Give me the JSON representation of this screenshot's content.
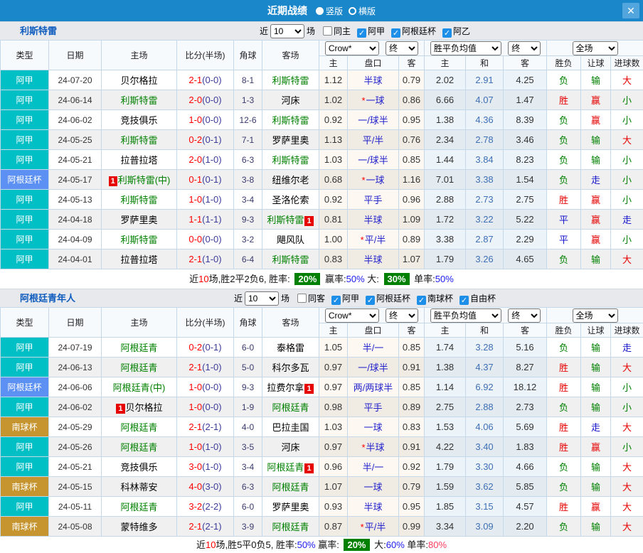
{
  "titlebar": {
    "title": "近期战绩",
    "vertical": "竖版",
    "horizontal": "横版",
    "close": "✕"
  },
  "table_headers": {
    "type": "类型",
    "date": "日期",
    "home": "主场",
    "score": "比分(半场)",
    "corner": "角球",
    "away": "客场",
    "ah_select": "Crow*",
    "ah_final": "终",
    "odds_select": "胜平负均值",
    "odds_final": "终",
    "scope_select": "全场",
    "ah_sub": [
      "主",
      "盘口",
      "客"
    ],
    "odds_sub": [
      "主",
      "和",
      "客"
    ],
    "res_sub": [
      "胜负",
      "让球",
      "进球数"
    ]
  },
  "colors": {
    "league": {
      "teal": "#00bfc5",
      "blue": "#5c90f2",
      "gold": "#c6952f"
    },
    "result": {
      "red": "#e60000",
      "green": "#008000",
      "blue": "#1414cc"
    },
    "accent_bar": "#1b87cb",
    "summary_badge": "#008000",
    "checkbox": "#1e8fe8"
  },
  "sections": [
    {
      "team": "利斯特雷",
      "filters": {
        "near_label": "近",
        "games": "10",
        "games_label": "场",
        "same_label": "同主",
        "same_checked": false,
        "leagues": [
          "阿甲",
          "阿根廷杯",
          "阿乙"
        ]
      },
      "rows": [
        {
          "league": "阿甲",
          "lc": "teal",
          "date": "24-07-20",
          "h": {
            "n": "贝尔格拉",
            "g": false,
            "b": ""
          },
          "ft": "2-1",
          "ht": "(0-0)",
          "cr": "8-1",
          "a": {
            "n": "利斯特雷",
            "g": true,
            "b": ""
          },
          "ah": [
            "1.12",
            "半球",
            false,
            "0.79"
          ],
          "od": [
            "2.02",
            "2.91",
            "4.25"
          ],
          "res": [
            [
              "负",
              "green"
            ],
            [
              "输",
              "green"
            ],
            [
              "大",
              "red"
            ]
          ]
        },
        {
          "league": "阿甲",
          "lc": "teal",
          "date": "24-06-14",
          "h": {
            "n": "利斯特雷",
            "g": true,
            "b": ""
          },
          "ft": "2-0",
          "ht": "(0-0)",
          "cr": "1-3",
          "a": {
            "n": "河床",
            "g": false,
            "b": ""
          },
          "ah": [
            "1.02",
            "一球",
            true,
            "0.86"
          ],
          "od": [
            "6.66",
            "4.07",
            "1.47"
          ],
          "res": [
            [
              "胜",
              "red"
            ],
            [
              "赢",
              "red"
            ],
            [
              "小",
              "green"
            ]
          ]
        },
        {
          "league": "阿甲",
          "lc": "teal",
          "date": "24-06-02",
          "h": {
            "n": "竞技俱乐",
            "g": false,
            "b": ""
          },
          "ft": "1-0",
          "ht": "(0-0)",
          "cr": "12-6",
          "a": {
            "n": "利斯特雷",
            "g": true,
            "b": ""
          },
          "ah": [
            "0.92",
            "一/球半",
            false,
            "0.95"
          ],
          "od": [
            "1.38",
            "4.36",
            "8.39"
          ],
          "res": [
            [
              "负",
              "green"
            ],
            [
              "赢",
              "red"
            ],
            [
              "小",
              "green"
            ]
          ]
        },
        {
          "league": "阿甲",
          "lc": "teal",
          "date": "24-05-25",
          "h": {
            "n": "利斯特雷",
            "g": true,
            "b": ""
          },
          "ft": "0-2",
          "ht": "(0-1)",
          "cr": "7-1",
          "a": {
            "n": "罗萨里奥",
            "g": false,
            "b": ""
          },
          "ah": [
            "1.13",
            "平/半",
            false,
            "0.76"
          ],
          "od": [
            "2.34",
            "2.78",
            "3.46"
          ],
          "res": [
            [
              "负",
              "green"
            ],
            [
              "输",
              "green"
            ],
            [
              "大",
              "red"
            ]
          ]
        },
        {
          "league": "阿甲",
          "lc": "teal",
          "date": "24-05-21",
          "h": {
            "n": "拉普拉塔",
            "g": false,
            "b": ""
          },
          "ft": "2-0",
          "ht": "(1-0)",
          "cr": "6-3",
          "a": {
            "n": "利斯特雷",
            "g": true,
            "b": ""
          },
          "ah": [
            "1.03",
            "一/球半",
            false,
            "0.85"
          ],
          "od": [
            "1.44",
            "3.84",
            "8.23"
          ],
          "res": [
            [
              "负",
              "green"
            ],
            [
              "输",
              "green"
            ],
            [
              "小",
              "green"
            ]
          ]
        },
        {
          "league": "阿根廷杯",
          "lc": "blue",
          "date": "24-05-17",
          "h": {
            "n": "利斯特雷(中)",
            "g": true,
            "b": "1"
          },
          "ft": "0-1",
          "ht": "(0-1)",
          "cr": "3-8",
          "a": {
            "n": "纽维尔老",
            "g": false,
            "b": ""
          },
          "ah": [
            "0.68",
            "一球",
            true,
            "1.16"
          ],
          "od": [
            "7.01",
            "3.38",
            "1.54"
          ],
          "res": [
            [
              "负",
              "green"
            ],
            [
              "走",
              "blue"
            ],
            [
              "小",
              "green"
            ]
          ]
        },
        {
          "league": "阿甲",
          "lc": "teal",
          "date": "24-05-13",
          "h": {
            "n": "利斯特雷",
            "g": true,
            "b": ""
          },
          "ft": "1-0",
          "ht": "(1-0)",
          "cr": "3-4",
          "a": {
            "n": "圣洛伦索",
            "g": false,
            "b": ""
          },
          "ah": [
            "0.92",
            "平手",
            false,
            "0.96"
          ],
          "od": [
            "2.88",
            "2.73",
            "2.75"
          ],
          "res": [
            [
              "胜",
              "red"
            ],
            [
              "赢",
              "red"
            ],
            [
              "小",
              "green"
            ]
          ]
        },
        {
          "league": "阿甲",
          "lc": "teal",
          "date": "24-04-18",
          "h": {
            "n": "罗萨里奥",
            "g": false,
            "b": ""
          },
          "ft": "1-1",
          "ht": "(1-1)",
          "cr": "9-3",
          "a": {
            "n": "利斯特雷",
            "g": true,
            "b": "1"
          },
          "ah": [
            "0.81",
            "半球",
            false,
            "1.09"
          ],
          "od": [
            "1.72",
            "3.22",
            "5.22"
          ],
          "res": [
            [
              "平",
              "blue"
            ],
            [
              "赢",
              "red"
            ],
            [
              "走",
              "blue"
            ]
          ]
        },
        {
          "league": "阿甲",
          "lc": "teal",
          "date": "24-04-09",
          "h": {
            "n": "利斯特雷",
            "g": true,
            "b": ""
          },
          "ft": "0-0",
          "ht": "(0-0)",
          "cr": "3-2",
          "a": {
            "n": "飓风队",
            "g": false,
            "b": ""
          },
          "ah": [
            "1.00",
            "平/半",
            true,
            "0.89"
          ],
          "od": [
            "3.38",
            "2.87",
            "2.29"
          ],
          "res": [
            [
              "平",
              "blue"
            ],
            [
              "赢",
              "red"
            ],
            [
              "小",
              "green"
            ]
          ]
        },
        {
          "league": "阿甲",
          "lc": "teal",
          "date": "24-04-01",
          "h": {
            "n": "拉普拉塔",
            "g": false,
            "b": ""
          },
          "ft": "2-1",
          "ht": "(1-0)",
          "cr": "6-4",
          "a": {
            "n": "利斯特雷",
            "g": true,
            "b": ""
          },
          "ah": [
            "0.83",
            "半球",
            false,
            "1.07"
          ],
          "od": [
            "1.79",
            "3.26",
            "4.65"
          ],
          "res": [
            [
              "负",
              "green"
            ],
            [
              "输",
              "green"
            ],
            [
              "大",
              "red"
            ]
          ]
        }
      ],
      "summary": [
        {
          "t": "近",
          "s": "plain"
        },
        {
          "t": "10",
          "s": "red"
        },
        {
          "t": "场,胜2平2负6, 胜率: ",
          "s": "plain"
        },
        {
          "t": "20%",
          "s": "greenbg"
        },
        {
          "t": " 赢率:",
          "s": "plain"
        },
        {
          "t": "50%",
          "s": "blue"
        },
        {
          "t": " 大: ",
          "s": "plain"
        },
        {
          "t": "30%",
          "s": "greenbg"
        },
        {
          "t": " 单率:",
          "s": "plain"
        },
        {
          "t": "50%",
          "s": "blue"
        }
      ]
    },
    {
      "team": "阿根廷青年人",
      "filters": {
        "near_label": "近",
        "games": "10",
        "games_label": "场",
        "same_label": "同客",
        "same_checked": false,
        "leagues": [
          "阿甲",
          "阿根廷杯",
          "南球杯",
          "自由杯"
        ]
      },
      "rows": [
        {
          "league": "阿甲",
          "lc": "teal",
          "date": "24-07-19",
          "h": {
            "n": "阿根廷青",
            "g": true,
            "b": ""
          },
          "ft": "0-2",
          "ht": "(0-1)",
          "cr": "6-0",
          "a": {
            "n": "泰格雷",
            "g": false,
            "b": ""
          },
          "ah": [
            "1.05",
            "半/一",
            false,
            "0.85"
          ],
          "od": [
            "1.74",
            "3.28",
            "5.16"
          ],
          "res": [
            [
              "负",
              "green"
            ],
            [
              "输",
              "green"
            ],
            [
              "走",
              "blue"
            ]
          ]
        },
        {
          "league": "阿甲",
          "lc": "teal",
          "date": "24-06-13",
          "h": {
            "n": "阿根廷青",
            "g": true,
            "b": ""
          },
          "ft": "2-1",
          "ht": "(1-0)",
          "cr": "5-0",
          "a": {
            "n": "科尔多瓦",
            "g": false,
            "b": ""
          },
          "ah": [
            "0.97",
            "一/球半",
            false,
            "0.91"
          ],
          "od": [
            "1.38",
            "4.37",
            "8.27"
          ],
          "res": [
            [
              "胜",
              "red"
            ],
            [
              "输",
              "green"
            ],
            [
              "大",
              "red"
            ]
          ]
        },
        {
          "league": "阿根廷杯",
          "lc": "blue",
          "date": "24-06-06",
          "h": {
            "n": "阿根廷青(中)",
            "g": true,
            "b": ""
          },
          "ft": "1-0",
          "ht": "(0-0)",
          "cr": "9-3",
          "a": {
            "n": "拉费尔拿",
            "g": false,
            "b": "1"
          },
          "ah": [
            "0.97",
            "两/两球半",
            false,
            "0.85"
          ],
          "od": [
            "1.14",
            "6.92",
            "18.12"
          ],
          "res": [
            [
              "胜",
              "red"
            ],
            [
              "输",
              "green"
            ],
            [
              "小",
              "green"
            ]
          ]
        },
        {
          "league": "阿甲",
          "lc": "teal",
          "date": "24-06-02",
          "h": {
            "n": "贝尔格拉",
            "g": false,
            "b": "1"
          },
          "ft": "1-0",
          "ht": "(0-0)",
          "cr": "1-9",
          "a": {
            "n": "阿根廷青",
            "g": true,
            "b": ""
          },
          "ah": [
            "0.98",
            "平手",
            false,
            "0.89"
          ],
          "od": [
            "2.75",
            "2.88",
            "2.73"
          ],
          "res": [
            [
              "负",
              "green"
            ],
            [
              "输",
              "green"
            ],
            [
              "小",
              "green"
            ]
          ]
        },
        {
          "league": "南球杯",
          "lc": "gold",
          "date": "24-05-29",
          "h": {
            "n": "阿根廷青",
            "g": true,
            "b": ""
          },
          "ft": "2-1",
          "ht": "(2-1)",
          "cr": "4-0",
          "a": {
            "n": "巴拉圭国",
            "g": false,
            "b": ""
          },
          "ah": [
            "1.03",
            "一球",
            false,
            "0.83"
          ],
          "od": [
            "1.53",
            "4.06",
            "5.69"
          ],
          "res": [
            [
              "胜",
              "red"
            ],
            [
              "走",
              "blue"
            ],
            [
              "大",
              "red"
            ]
          ]
        },
        {
          "league": "阿甲",
          "lc": "teal",
          "date": "24-05-26",
          "h": {
            "n": "阿根廷青",
            "g": true,
            "b": ""
          },
          "ft": "1-0",
          "ht": "(1-0)",
          "cr": "3-5",
          "a": {
            "n": "河床",
            "g": false,
            "b": ""
          },
          "ah": [
            "0.97",
            "半球",
            true,
            "0.91"
          ],
          "od": [
            "4.22",
            "3.40",
            "1.83"
          ],
          "res": [
            [
              "胜",
              "red"
            ],
            [
              "赢",
              "red"
            ],
            [
              "小",
              "green"
            ]
          ]
        },
        {
          "league": "阿甲",
          "lc": "teal",
          "date": "24-05-21",
          "h": {
            "n": "竞技俱乐",
            "g": false,
            "b": ""
          },
          "ft": "3-0",
          "ht": "(1-0)",
          "cr": "3-4",
          "a": {
            "n": "阿根廷青",
            "g": true,
            "b": "1"
          },
          "ah": [
            "0.96",
            "半/一",
            false,
            "0.92"
          ],
          "od": [
            "1.79",
            "3.30",
            "4.66"
          ],
          "res": [
            [
              "负",
              "green"
            ],
            [
              "输",
              "green"
            ],
            [
              "大",
              "red"
            ]
          ]
        },
        {
          "league": "南球杯",
          "lc": "gold",
          "date": "24-05-15",
          "h": {
            "n": "科林蒂安",
            "g": false,
            "b": ""
          },
          "ft": "4-0",
          "ht": "(3-0)",
          "cr": "6-3",
          "a": {
            "n": "阿根廷青",
            "g": true,
            "b": ""
          },
          "ah": [
            "1.07",
            "一球",
            false,
            "0.79"
          ],
          "od": [
            "1.59",
            "3.62",
            "5.85"
          ],
          "res": [
            [
              "负",
              "green"
            ],
            [
              "输",
              "green"
            ],
            [
              "大",
              "red"
            ]
          ]
        },
        {
          "league": "阿甲",
          "lc": "teal",
          "date": "24-05-11",
          "h": {
            "n": "阿根廷青",
            "g": true,
            "b": ""
          },
          "ft": "3-2",
          "ht": "(2-2)",
          "cr": "6-0",
          "a": {
            "n": "罗萨里奥",
            "g": false,
            "b": ""
          },
          "ah": [
            "0.93",
            "半球",
            false,
            "0.95"
          ],
          "od": [
            "1.85",
            "3.15",
            "4.57"
          ],
          "res": [
            [
              "胜",
              "red"
            ],
            [
              "赢",
              "red"
            ],
            [
              "大",
              "red"
            ]
          ]
        },
        {
          "league": "南球杯",
          "lc": "gold",
          "date": "24-05-08",
          "h": {
            "n": "蒙特维多",
            "g": false,
            "b": ""
          },
          "ft": "2-1",
          "ht": "(2-1)",
          "cr": "3-9",
          "a": {
            "n": "阿根廷青",
            "g": true,
            "b": ""
          },
          "ah": [
            "0.87",
            "平/半",
            true,
            "0.99"
          ],
          "od": [
            "3.34",
            "3.09",
            "2.20"
          ],
          "res": [
            [
              "负",
              "green"
            ],
            [
              "输",
              "green"
            ],
            [
              "大",
              "red"
            ]
          ]
        }
      ],
      "summary": [
        {
          "t": "近",
          "s": "plain"
        },
        {
          "t": "10",
          "s": "red"
        },
        {
          "t": "场,胜5平0负5, 胜率:",
          "s": "plain"
        },
        {
          "t": "50%",
          "s": "blue"
        },
        {
          "t": " 赢率: ",
          "s": "plain"
        },
        {
          "t": "20%",
          "s": "greenbg"
        },
        {
          "t": " 大:",
          "s": "plain"
        },
        {
          "t": "60%",
          "s": "blue"
        },
        {
          "t": " 单率:",
          "s": "plain"
        },
        {
          "t": "80%",
          "s": "pink"
        }
      ]
    }
  ]
}
